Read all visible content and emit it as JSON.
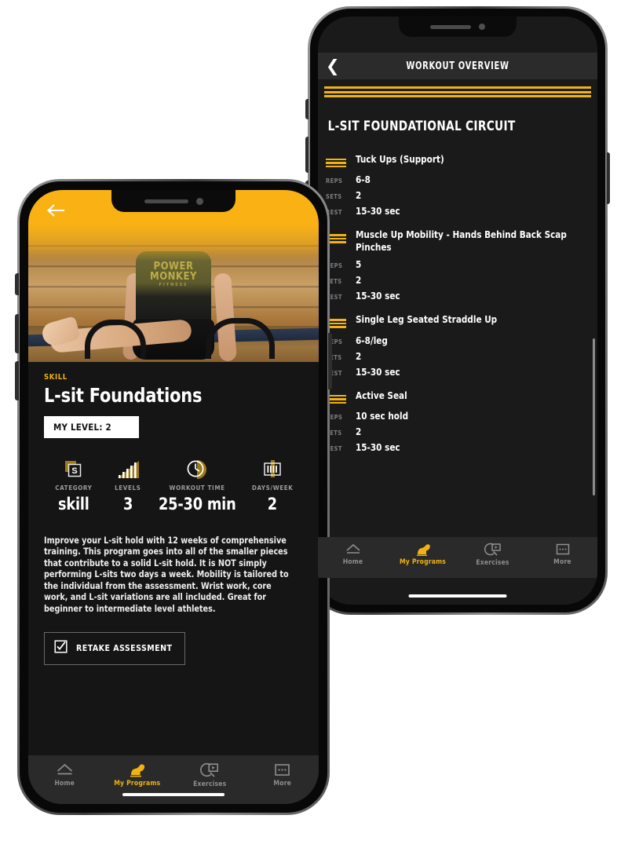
{
  "rear_phone": {
    "header": {
      "title": "WORKOUT OVERVIEW",
      "back_icon": "chevron-left-icon"
    },
    "circuit_title": "L-SIT FOUNDATIONAL CIRCUIT",
    "labels": {
      "reps": "REPS",
      "sets": "SETS",
      "rest": "REST"
    },
    "exercises": [
      {
        "name": "Tuck Ups (Support)",
        "reps": "6-8",
        "sets": "2",
        "rest": "15-30 sec"
      },
      {
        "name": "Muscle Up Mobility - Hands Behind Back Scap Pinches",
        "reps": "5",
        "sets": "2",
        "rest": "15-30 sec"
      },
      {
        "name": "Single Leg Seated Straddle Up",
        "reps": "6-8/leg",
        "sets": "2",
        "rest": "15-30 sec"
      },
      {
        "name": "Active Seal",
        "reps": "10 sec hold",
        "sets": "2",
        "rest": "15-30 sec"
      }
    ],
    "tabbar": [
      {
        "label": "Home",
        "icon": "home-icon",
        "active": false
      },
      {
        "label": "My Programs",
        "icon": "bicep-icon",
        "active": true
      },
      {
        "label": "Exercises",
        "icon": "video-search-icon",
        "active": false
      },
      {
        "label": "More",
        "icon": "more-dots-icon",
        "active": false
      }
    ]
  },
  "front_phone": {
    "hero": {
      "back_icon": "arrow-left-icon",
      "shirt_text_line1": "POWER",
      "shirt_text_line2": "MONKEY",
      "shirt_text_line3": "FITNESS"
    },
    "kicker": "SKILL",
    "title": "L-sit Foundations",
    "level_badge": "MY LEVEL: 2",
    "stats": [
      {
        "caption": "CATEGORY",
        "value": "skill",
        "icon": "skill-square-icon"
      },
      {
        "caption": "LEVELS",
        "value": "3",
        "icon": "bar-chart-icon"
      },
      {
        "caption": "WORKOUT TIME",
        "value": "25-30 min",
        "icon": "clock-icon"
      },
      {
        "caption": "DAYS/WEEK",
        "value": "2",
        "icon": "calendar-icon"
      }
    ],
    "description": "Improve your L-sit hold with 12 weeks of comprehensive training. This program goes into all of the smaller pieces that contribute to a solid L-sit hold. It is NOT simply performing L-sits two days a week. Mobility is tailored to the individual from the assessment. Wrist work, core work, and L-sit variations are all included. Great for beginner to intermediate level athletes.",
    "retake_button": {
      "label": "RETAKE ASSESSMENT",
      "icon": "checkbox-check-icon"
    },
    "tabbar": [
      {
        "label": "Home",
        "icon": "home-icon",
        "active": false
      },
      {
        "label": "My Programs",
        "icon": "bicep-icon",
        "active": true
      },
      {
        "label": "Exercises",
        "icon": "video-search-icon",
        "active": false
      },
      {
        "label": "More",
        "icon": "more-dots-icon",
        "active": false
      }
    ]
  },
  "colors": {
    "accent": "#F0B310",
    "hero_yellow": "#F9B113",
    "screen_bg": "#1a1a1a",
    "tabbar_bg": "#2a2a2a"
  }
}
